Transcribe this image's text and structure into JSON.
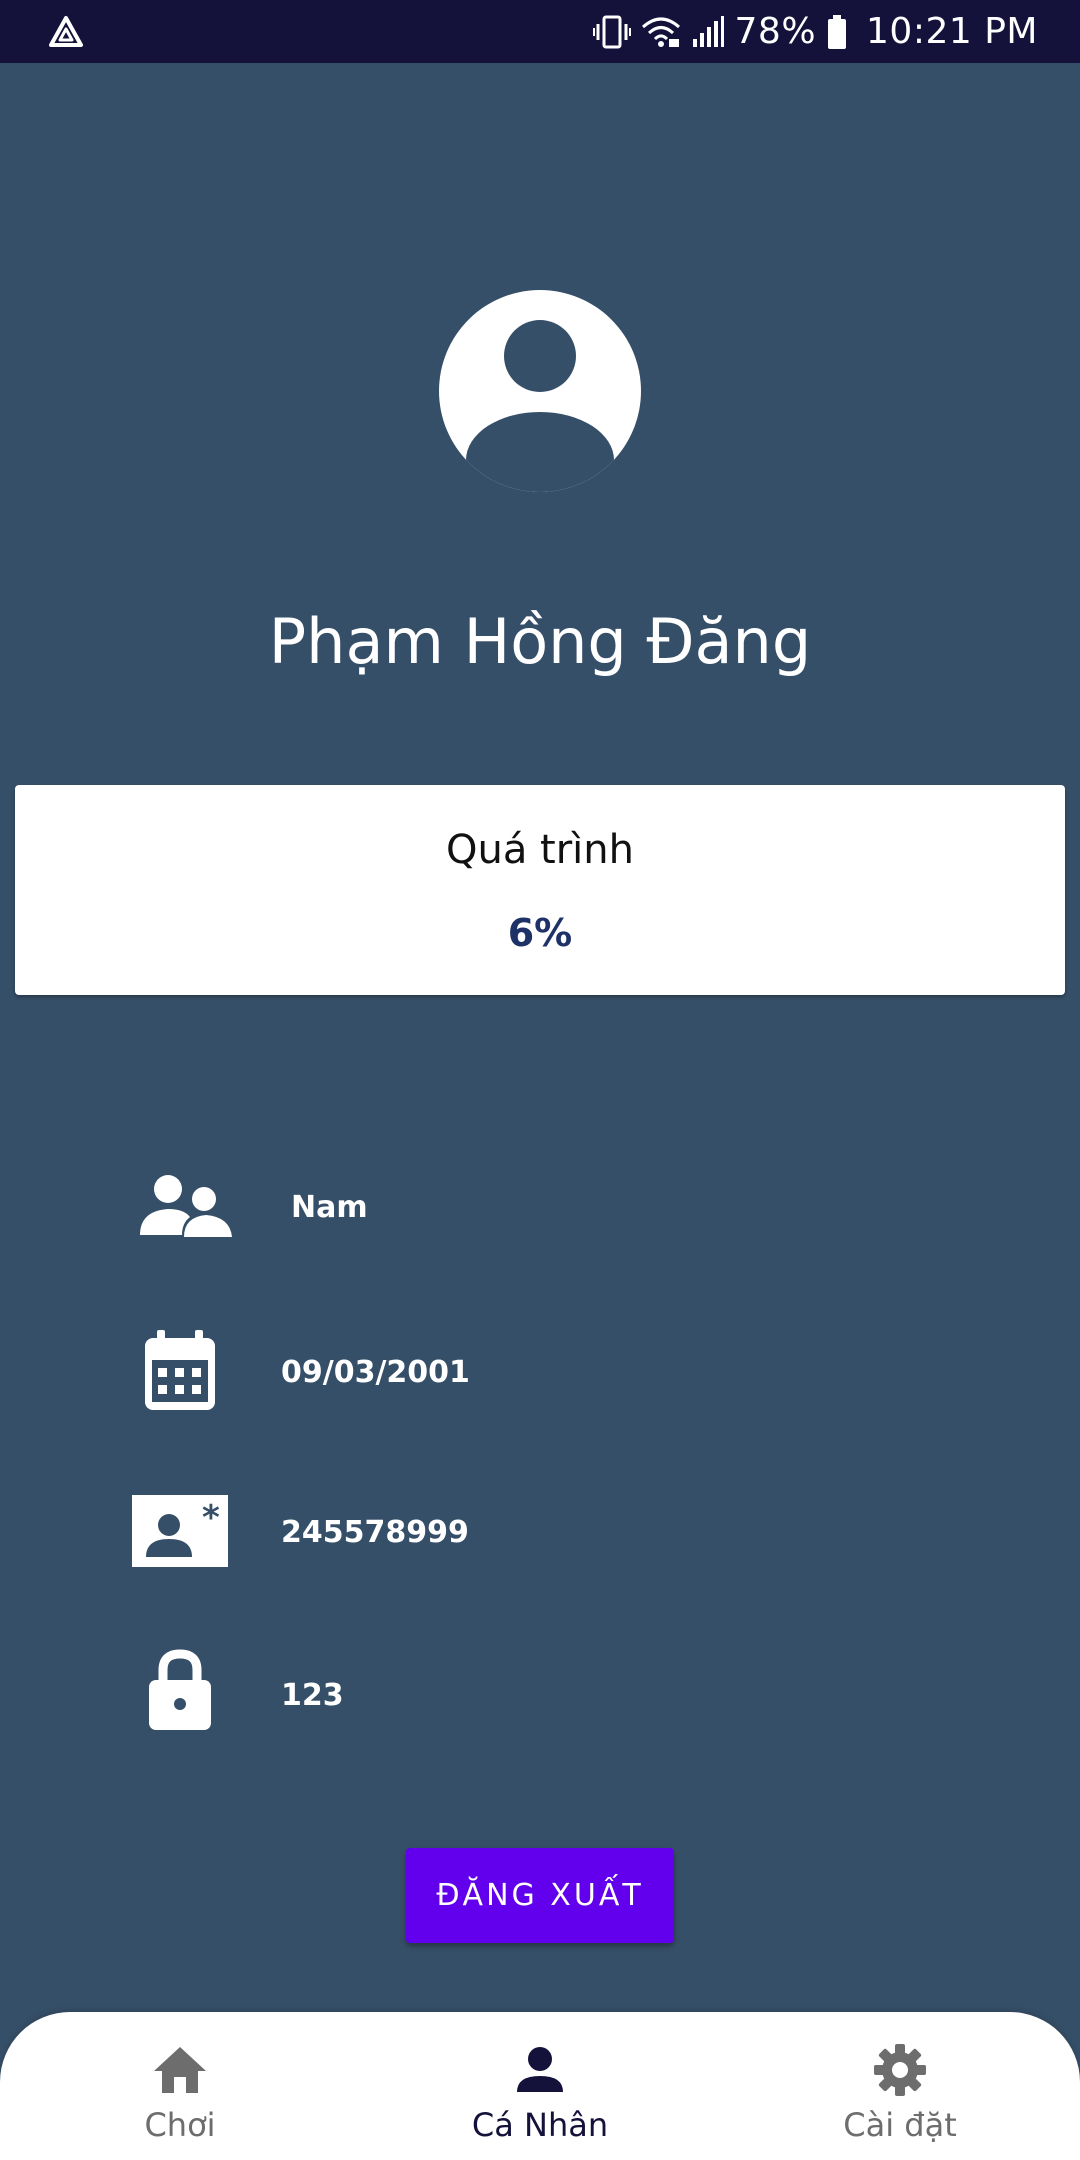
{
  "status_bar": {
    "battery": "78%",
    "time": "10:21 PM",
    "icons": [
      "app-logo-icon",
      "vibrate-icon",
      "wifi-icon",
      "signal-icon",
      "battery-icon"
    ]
  },
  "profile": {
    "name": "Phạm Hồng Đăng",
    "avatar_icon": "account-circle-icon"
  },
  "progress": {
    "title": "Quá trình",
    "value": "6%"
  },
  "info": {
    "gender": "Nam",
    "birthday": "09/03/2001",
    "id_number": "245578999",
    "password": "123"
  },
  "logout_label": "ĐĂNG XUẤT",
  "nav": {
    "items": [
      {
        "label": "Chơi",
        "icon": "home-icon",
        "active": false
      },
      {
        "label": "Cá Nhân",
        "icon": "person-icon",
        "active": true
      },
      {
        "label": "Cài đặt",
        "icon": "gear-icon",
        "active": false
      }
    ]
  },
  "colors": {
    "background": "#364f68",
    "status_bar": "#14123a",
    "accent": "#6200ee",
    "progress_text": "#1e3267"
  }
}
